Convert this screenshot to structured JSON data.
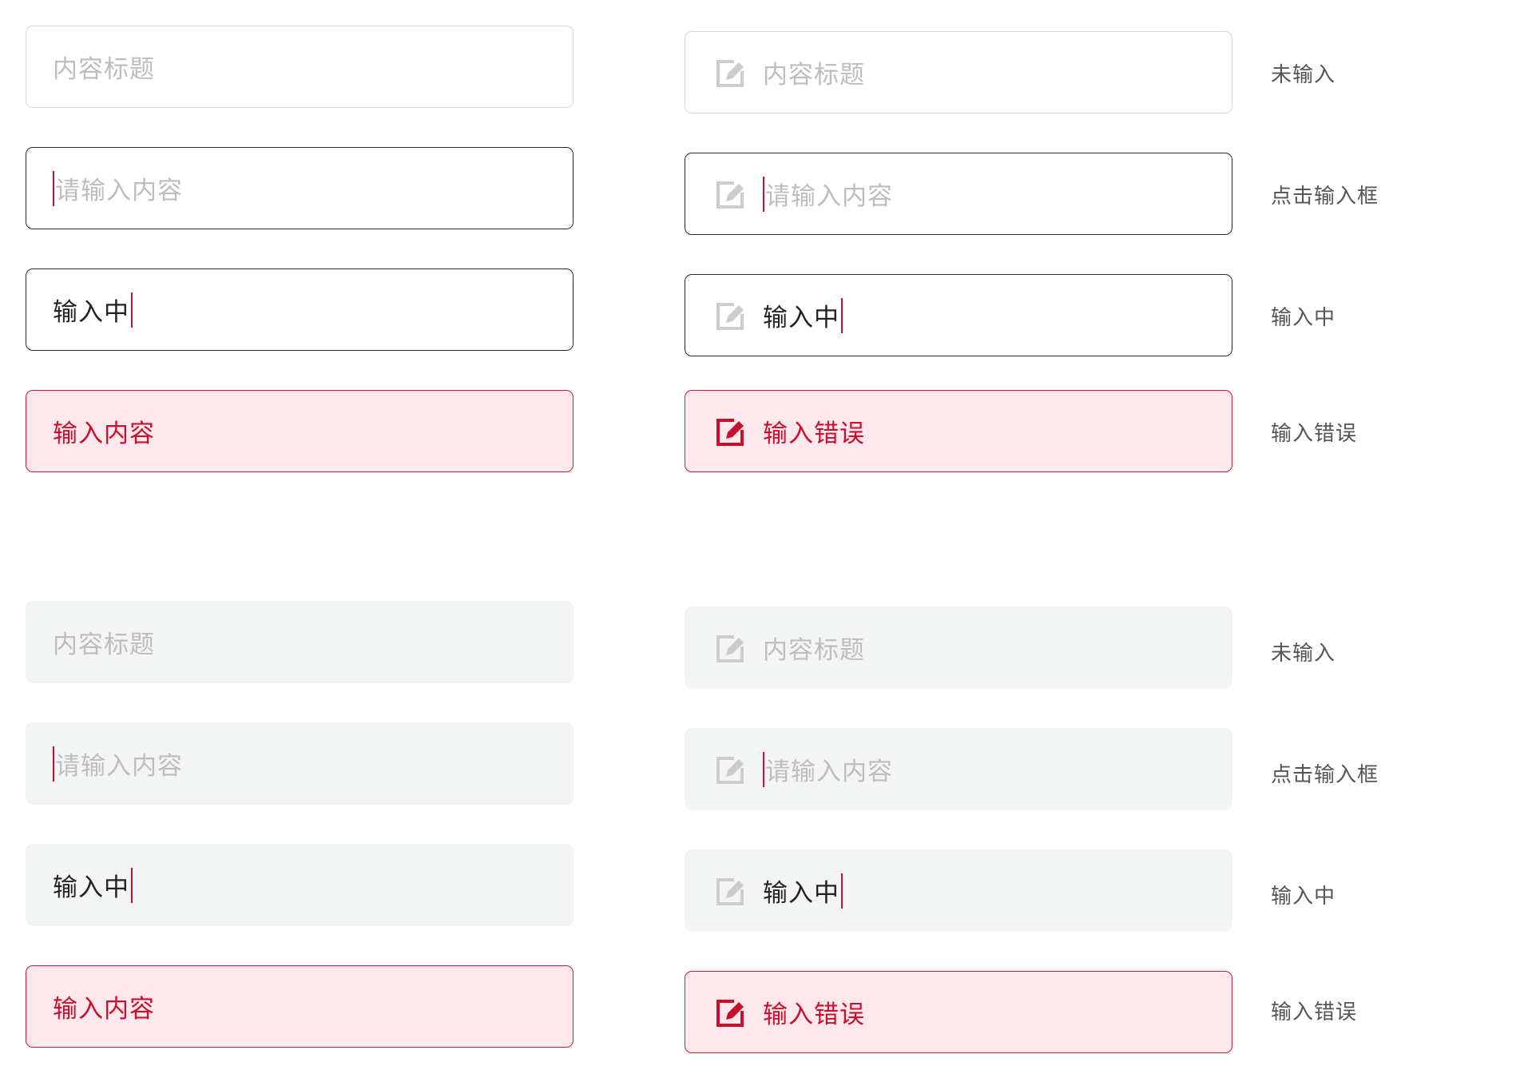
{
  "sections": [
    {
      "plain": [
        {
          "text": "内容标题",
          "state": "empty"
        },
        {
          "text": "请输入内容",
          "state": "focus"
        },
        {
          "text": "输入中",
          "state": "typing"
        },
        {
          "text": "输入内容",
          "state": "error"
        }
      ],
      "with_icon": [
        {
          "text": "内容标题",
          "state": "empty",
          "label": "未输入"
        },
        {
          "text": "请输入内容",
          "state": "focus",
          "label": "点击输入框"
        },
        {
          "text": "输入中",
          "state": "typing",
          "label": "输入中"
        },
        {
          "text": "输入错误",
          "state": "error",
          "label": "输入错误"
        }
      ]
    },
    {
      "plain": [
        {
          "text": "内容标题",
          "state": "empty"
        },
        {
          "text": "请输入内容",
          "state": "focus"
        },
        {
          "text": "输入中",
          "state": "typing"
        },
        {
          "text": "输入内容",
          "state": "error"
        }
      ],
      "with_icon": [
        {
          "text": "内容标题",
          "state": "empty",
          "label": "未输入"
        },
        {
          "text": "请输入内容",
          "state": "focus",
          "label": "点击输入框"
        },
        {
          "text": "输入中",
          "state": "typing",
          "label": "输入中"
        },
        {
          "text": "输入错误",
          "state": "error",
          "label": "输入错误"
        }
      ]
    }
  ],
  "icons": {
    "edit": "edit-icon"
  },
  "colors": {
    "accent": "#c8102e",
    "error_bg": "#ffe8ec",
    "filled_bg": "#f3f5f4",
    "placeholder": "#bdbdbd",
    "typed_text": "#222222",
    "label_text": "#555555"
  }
}
